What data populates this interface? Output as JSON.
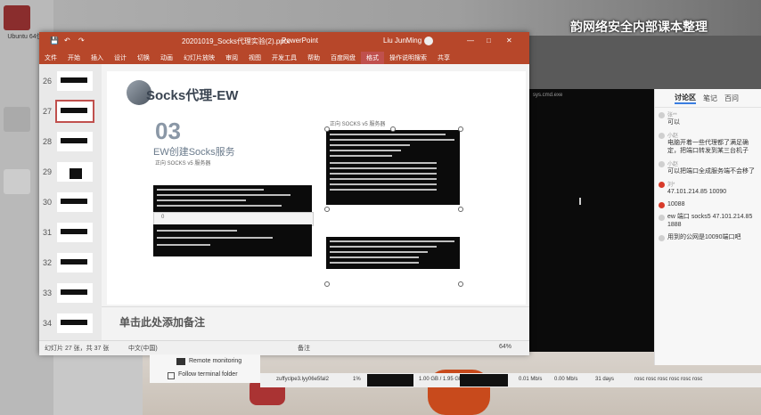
{
  "overlay_title": "韵网络安全内部课本整理",
  "desktop": {
    "icon_label": "Ubuntu 64位"
  },
  "ppt": {
    "title_filename": "20201019_Socks代理实验(2).pptx",
    "title_app": "PowerPoint",
    "title_user": "Liu JunMing",
    "ribbon": [
      "文件",
      "开始",
      "插入",
      "设计",
      "切换",
      "动画",
      "幻灯片放映",
      "审阅",
      "视图",
      "开发工具",
      "帮助",
      "百度网盘",
      "格式",
      "操作说明搜索",
      "共享"
    ],
    "thumb_numbers": [
      "26",
      "27",
      "28",
      "29",
      "30",
      "31",
      "32",
      "33",
      "34"
    ],
    "slide": {
      "title": "Socks代理-EW",
      "section_number": "03",
      "section_subtitle": "EW创建Socks服务",
      "subline": "正向 SOCKS v5 服务器",
      "right_caption": "正向 SOCKS v5 服务器"
    },
    "notes_placeholder": "单击此处添加备注",
    "status": {
      "slide_counter": "幻灯片 27 张，共 37 张",
      "language": "中文(中国)",
      "notes_btn": "备注",
      "zoom": "64%"
    }
  },
  "right_header": "sys.cmd.exe",
  "chat": {
    "tabs": [
      "讨论区",
      "笔记",
      "百问"
    ],
    "messages": [
      {
        "name": "张**",
        "text": "可以",
        "dot": "gray"
      },
      {
        "name": "小赵",
        "text": "电脑开着一些代理都了满足确定，把端口转发到某三台机子",
        "dot": "gray"
      },
      {
        "name": "小赵",
        "text": "可以把端口全成服务端不会移了",
        "dot": "gray"
      },
      {
        "name": "刘*",
        "text": "47.101.214.85 10090",
        "dot": "red"
      },
      {
        "name": "",
        "text": "10088",
        "dot": "red"
      },
      {
        "name": "",
        "text": "ew 端口 socks5 47.101.214.85 1888",
        "dot": "gray"
      },
      {
        "name": "",
        "text": "用到的公网是10090端口吧",
        "dot": "gray"
      }
    ]
  },
  "remote": {
    "item1": "Remote monitoring",
    "item2": "Follow terminal folder"
  },
  "taskbar": {
    "prompt": "zuffyclpe3.lyy06e5fal2",
    "cpu": "1%",
    "mem": "1.00 GB / 1.95 GB",
    "net_up": "0.01 Mb/s",
    "net_down": "0.00 Mb/s",
    "days": "31 days",
    "procs": "rosc rosc rosc rosc rosc rosc"
  },
  "colors": {
    "ppt_red": "#b7472a",
    "selected_outline": "#c0504d",
    "chat_accent": "#3a7de0"
  }
}
